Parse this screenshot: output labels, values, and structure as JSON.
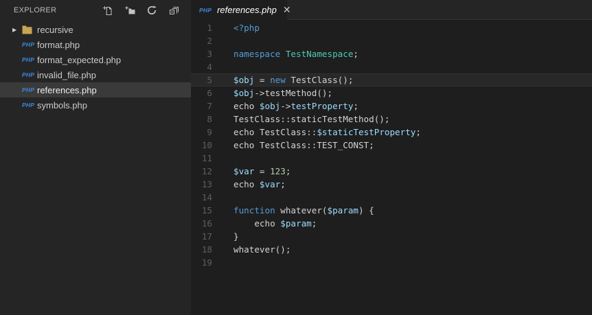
{
  "colors": {
    "sidebar_bg": "#252526",
    "editor_bg": "#1e1e1e",
    "selected_row_bg": "#3a3a3a",
    "keyword": "#569cd6",
    "class_name": "#4ec9b0",
    "variable": "#9cdcfe",
    "number": "#b5cea8",
    "plain_code": "#d4d4d4",
    "line_number": "#5f5f5f",
    "php_badge": "#3f87d6",
    "folder_icon": "#c8a552"
  },
  "sidebar": {
    "title": "EXPLORER",
    "actions": [
      {
        "name": "new-file"
      },
      {
        "name": "new-folder"
      },
      {
        "name": "refresh"
      },
      {
        "name": "collapse-all"
      }
    ],
    "php_badge_text": "PHP",
    "items": [
      {
        "kind": "folder",
        "label": "recursive",
        "collapsed": true,
        "selected": false
      },
      {
        "kind": "php-file",
        "label": "format.php",
        "selected": false
      },
      {
        "kind": "php-file",
        "label": "format_expected.php",
        "selected": false
      },
      {
        "kind": "php-file",
        "label": "invalid_file.php",
        "selected": false
      },
      {
        "kind": "php-file",
        "label": "references.php",
        "selected": true
      },
      {
        "kind": "php-file",
        "label": "symbols.php",
        "selected": false
      }
    ]
  },
  "tabbar": {
    "tabs": [
      {
        "label": "references.php",
        "icon_text": "PHP",
        "active": true,
        "preview": true,
        "close_glyph": "✕"
      }
    ]
  },
  "editor": {
    "language": "php",
    "current_line": 5,
    "lines": [
      {
        "n": 1,
        "tokens": [
          [
            "kw",
            "<?php"
          ]
        ]
      },
      {
        "n": 2,
        "tokens": []
      },
      {
        "n": 3,
        "tokens": [
          [
            "kw",
            "namespace "
          ],
          [
            "cls",
            "TestNamespace"
          ],
          [
            "def",
            ";"
          ]
        ]
      },
      {
        "n": 4,
        "tokens": []
      },
      {
        "n": 5,
        "tokens": [
          [
            "var",
            "$obj"
          ],
          [
            "def",
            " = "
          ],
          [
            "kw",
            "new"
          ],
          [
            "def",
            " TestClass();"
          ]
        ]
      },
      {
        "n": 6,
        "tokens": [
          [
            "var",
            "$obj"
          ],
          [
            "def",
            "->testMethod();"
          ]
        ]
      },
      {
        "n": 7,
        "tokens": [
          [
            "def",
            "echo "
          ],
          [
            "var",
            "$obj"
          ],
          [
            "def",
            "->"
          ],
          [
            "var",
            "testProperty"
          ],
          [
            "def",
            ";"
          ]
        ]
      },
      {
        "n": 8,
        "tokens": [
          [
            "def",
            "TestClass::staticTestMethod();"
          ]
        ]
      },
      {
        "n": 9,
        "tokens": [
          [
            "def",
            "echo TestClass::"
          ],
          [
            "var",
            "$staticTestProperty"
          ],
          [
            "def",
            ";"
          ]
        ]
      },
      {
        "n": 10,
        "tokens": [
          [
            "def",
            "echo TestClass::TEST_CONST;"
          ]
        ]
      },
      {
        "n": 11,
        "tokens": []
      },
      {
        "n": 12,
        "tokens": [
          [
            "var",
            "$var"
          ],
          [
            "def",
            " = "
          ],
          [
            "num",
            "123"
          ],
          [
            "def",
            ";"
          ]
        ]
      },
      {
        "n": 13,
        "tokens": [
          [
            "def",
            "echo "
          ],
          [
            "var",
            "$var"
          ],
          [
            "def",
            ";"
          ]
        ]
      },
      {
        "n": 14,
        "tokens": []
      },
      {
        "n": 15,
        "tokens": [
          [
            "kw",
            "function"
          ],
          [
            "def",
            " whatever("
          ],
          [
            "var",
            "$param"
          ],
          [
            "def",
            ") {"
          ]
        ]
      },
      {
        "n": 16,
        "tokens": [
          [
            "def",
            "    echo "
          ],
          [
            "var",
            "$param"
          ],
          [
            "def",
            ";"
          ]
        ]
      },
      {
        "n": 17,
        "tokens": [
          [
            "def",
            "}"
          ]
        ]
      },
      {
        "n": 18,
        "tokens": [
          [
            "def",
            "whatever();"
          ]
        ]
      },
      {
        "n": 19,
        "tokens": []
      }
    ]
  }
}
